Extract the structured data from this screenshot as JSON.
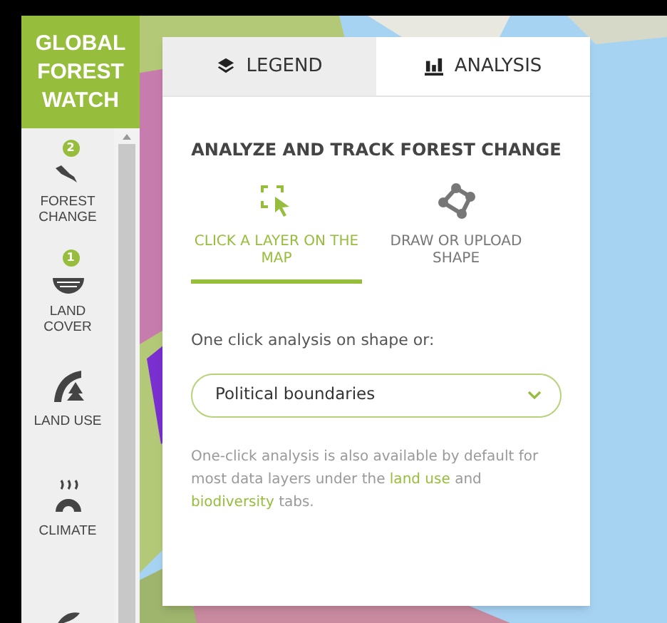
{
  "logo": {
    "lines": [
      "GLOBAL",
      "FOREST",
      "WATCH"
    ]
  },
  "sidebar": {
    "items": [
      {
        "kind": "forest",
        "label": "FOREST CHANGE",
        "badge": "2"
      },
      {
        "kind": "cover",
        "label": "LAND COVER",
        "badge": "1"
      },
      {
        "kind": "use",
        "label": "LAND USE"
      },
      {
        "kind": "climate",
        "label": "CLIMATE"
      },
      {
        "kind": "more"
      }
    ]
  },
  "panel": {
    "tabs": [
      {
        "kind": "legend",
        "label": "LEGEND",
        "selected": false
      },
      {
        "kind": "analysis",
        "label": "ANALYSIS",
        "selected": true
      }
    ],
    "heading": "ANALYZE AND TRACK FOREST CHANGE",
    "modes": [
      {
        "kind": "click",
        "label": "CLICK A LAYER ON THE MAP",
        "selected": true
      },
      {
        "kind": "draw",
        "label": "DRAW OR UPLOAD SHAPE",
        "selected": false
      }
    ],
    "prompt": "One click analysis on shape or:",
    "dropdown": {
      "value": "Political boundaries"
    },
    "note": {
      "before": "One-click analysis is also available by default for most data layers under the ",
      "link1": "land use",
      "middle": " and ",
      "link2": "biodiversity",
      "after": " tabs."
    }
  }
}
